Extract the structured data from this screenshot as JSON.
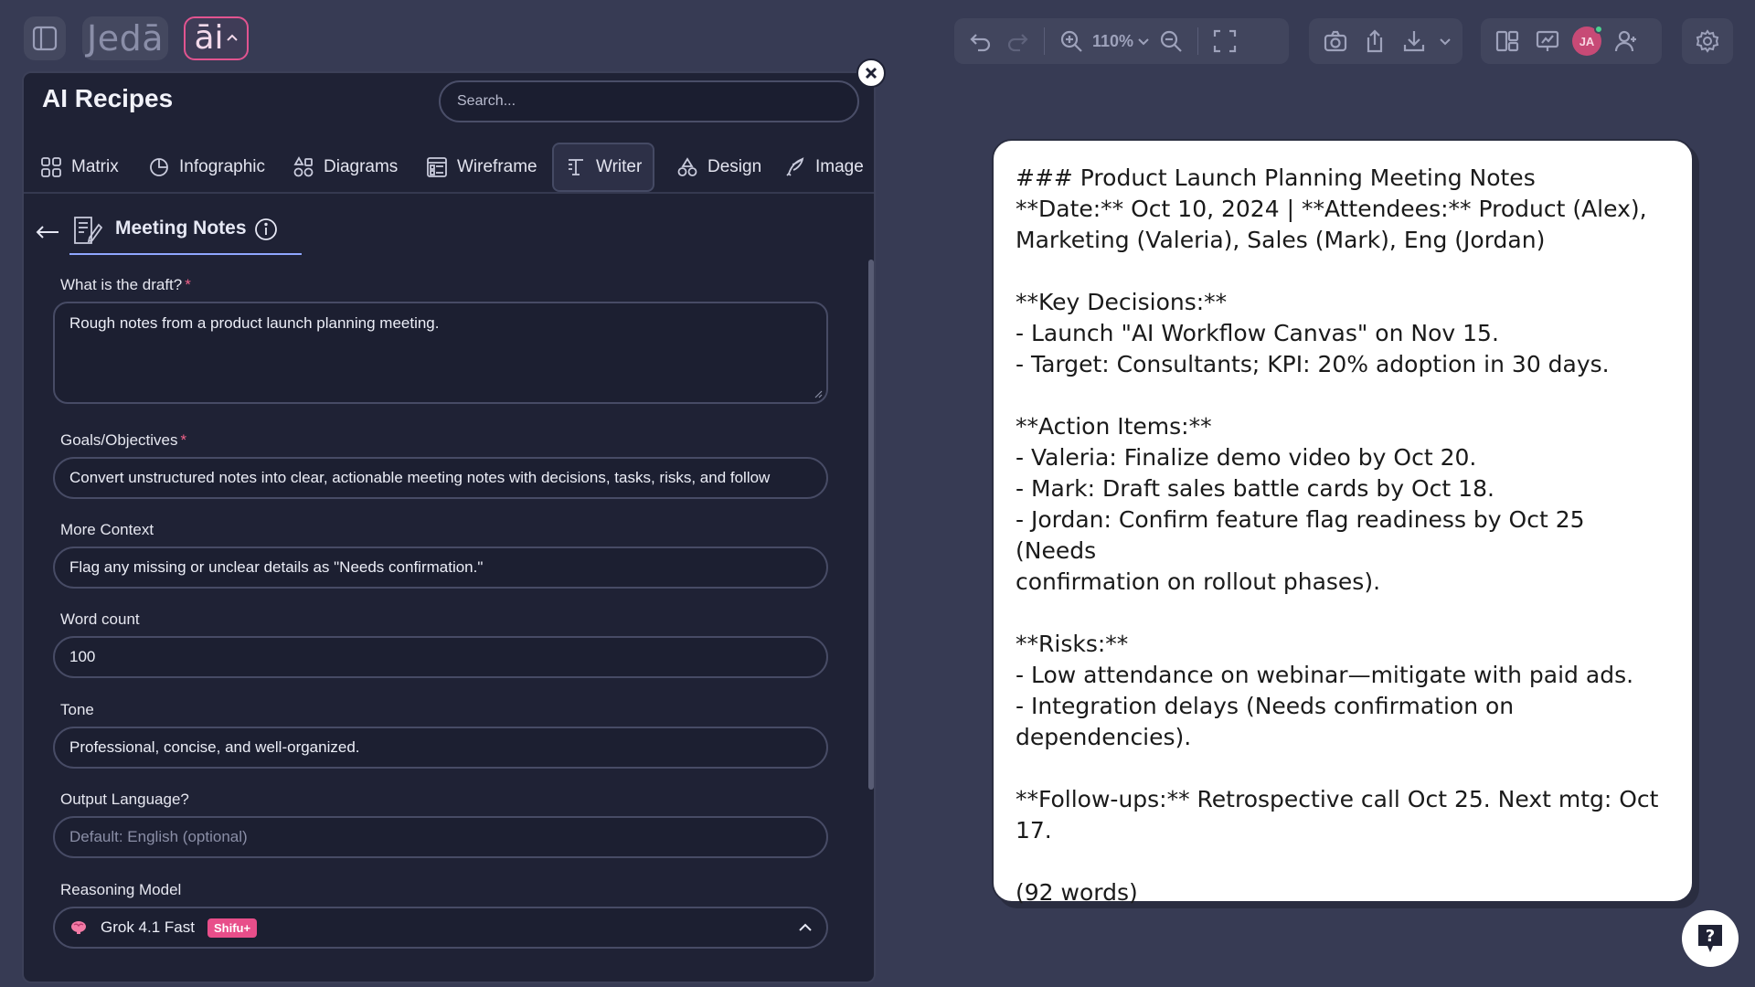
{
  "app": {
    "logo_text": "Jedā",
    "ai_button_text": "āi"
  },
  "toolbar": {
    "zoom": "110%",
    "avatar_initials": "JA"
  },
  "panel": {
    "title": "AI Recipes",
    "search_placeholder": "Search...",
    "tabs": [
      {
        "label": "Matrix",
        "icon": "matrix-icon"
      },
      {
        "label": "Infographic",
        "icon": "infographic-icon"
      },
      {
        "label": "Diagrams",
        "icon": "diagrams-icon"
      },
      {
        "label": "Wireframe",
        "icon": "wireframe-icon"
      },
      {
        "label": "Writer",
        "icon": "writer-icon"
      },
      {
        "label": "Design",
        "icon": "design-icon"
      },
      {
        "label": "Image",
        "icon": "image-icon"
      }
    ],
    "active_tab": "Writer",
    "recipe_title": "Meeting Notes",
    "fields": {
      "draft": {
        "label": "What is the draft?",
        "value": "Rough notes from a product launch planning meeting."
      },
      "goals": {
        "label": "Goals/Objectives",
        "value": "Convert unstructured notes into clear, actionable meeting notes with decisions, tasks, risks, and follow"
      },
      "context": {
        "label": "More Context",
        "value": "Flag any missing or unclear details as \"Needs confirmation.\""
      },
      "word_count": {
        "label": "Word count",
        "value": "100"
      },
      "tone": {
        "label": "Tone",
        "value": "Professional, concise, and well-organized."
      },
      "language": {
        "label": "Output Language?",
        "placeholder": "Default: English (optional)"
      },
      "model": {
        "label": "Reasoning Model",
        "value": "Grok 4.1 Fast",
        "badge": "Shifu+"
      }
    },
    "required_mark": "*"
  },
  "output": {
    "lines": [
      "### Product Launch Planning Meeting Notes",
      "**Date:** Oct 10, 2024 | **Attendees:** Product (Alex),",
      "Marketing (Valeria), Sales (Mark), Eng (Jordan)",
      "",
      "**Key Decisions:**",
      "- Launch \"AI Workflow Canvas\" on Nov 15.",
      "- Target: Consultants; KPI: 20% adoption in 30 days.",
      "",
      "**Action Items:**",
      "- Valeria: Finalize demo video by Oct 20.",
      "- Mark: Draft sales battle cards by Oct 18.",
      "- Jordan: Confirm feature flag readiness by Oct 25 (Needs",
      "confirmation on rollout phases).",
      "",
      "**Risks:**",
      "- Low attendance on webinar—mitigate with paid ads.",
      "- Integration delays (Needs confirmation on",
      "dependencies).",
      "",
      "**Follow-ups:** Retrospective call Oct 25. Next mtg: Oct",
      "17.",
      "",
      "(92 words)"
    ]
  },
  "colors": {
    "background": "#373b54",
    "panel": "#1f2235",
    "accent_pink": "#e25490",
    "badge": "#e84e8a"
  }
}
